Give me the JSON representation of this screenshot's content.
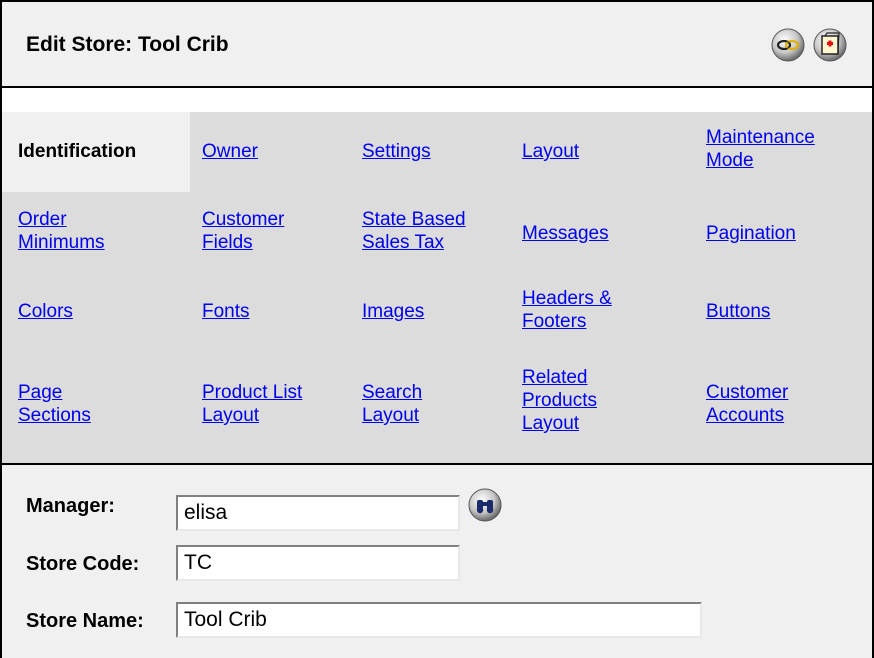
{
  "header": {
    "title": "Edit Store: Tool Crib",
    "icons": [
      "link-icon",
      "help-icon"
    ]
  },
  "tabs": [
    [
      "Identification",
      "Owner",
      "Settings",
      "Layout",
      "Maintenance Mode"
    ],
    [
      "Order Minimums",
      "Customer Fields",
      "State Based Sales Tax",
      "Messages",
      "Pagination"
    ],
    [
      "Colors",
      "Fonts",
      "Images",
      "Headers & Footers",
      "Buttons"
    ],
    [
      "Page Sections",
      "Product List Layout",
      "Search Layout",
      "Related Products Layout",
      "Customer Accounts"
    ]
  ],
  "active_tab": "Identification",
  "form": {
    "manager_label": "Manager:",
    "manager_value": "elisa",
    "store_code_label": "Store Code:",
    "store_code_value": "TC",
    "store_name_label": "Store Name:",
    "store_name_value": "Tool Crib",
    "lookup_icon": "binoculars-icon"
  },
  "colors": {
    "link": "#0000ee",
    "tab_bg": "#dcdcdc",
    "panel_bg": "#f0f0f0"
  }
}
